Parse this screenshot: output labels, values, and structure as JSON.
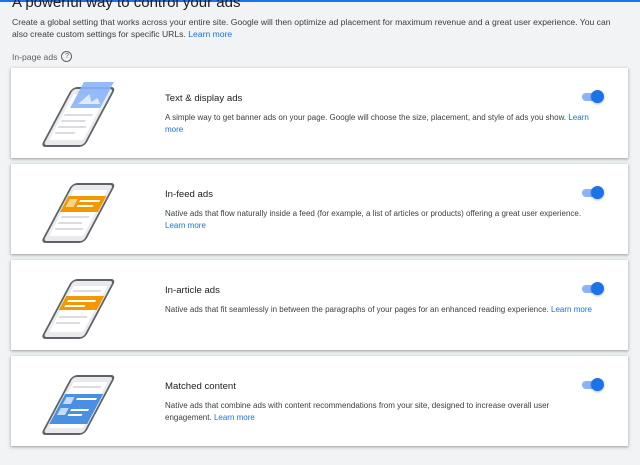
{
  "page": {
    "heading": "A powerful way to control your ads",
    "description": "Create a global setting that works across your entire site. Google will then optimize ad placement for maximum revenue and a great user experience. You can also create custom settings for specific URLs.",
    "description_link": "Learn more",
    "section_label": "In-page ads",
    "help_glyph": "?"
  },
  "colors": {
    "accent": "#1a73e8",
    "toggle_track": "#8ab4f8",
    "ad_blue": "#4a90e2",
    "ad_orange": "#f29900"
  },
  "cards": [
    {
      "title": "Text & display ads",
      "text": "A simple way to get banner ads on your page. Google will choose the size, placement, and style of ads you show.",
      "link": "Learn more",
      "enabled": true,
      "icon": "phone-display-ad-icon"
    },
    {
      "title": "In-feed ads",
      "text": "Native ads that flow naturally inside a feed (for example, a list of articles or products) offering a great user experience.",
      "link": "Learn more",
      "enabled": true,
      "icon": "phone-infeed-ad-icon"
    },
    {
      "title": "In-article ads",
      "text": "Native ads that fit seamlessly in between the paragraphs of your pages for an enhanced reading experience.",
      "link": "Learn more",
      "enabled": true,
      "icon": "phone-inarticle-ad-icon"
    },
    {
      "title": "Matched content",
      "text": "Native ads that combine ads with content recommendations from your site, designed to increase overall user engagement.",
      "link": "Learn more",
      "enabled": true,
      "icon": "phone-matched-content-icon"
    }
  ]
}
